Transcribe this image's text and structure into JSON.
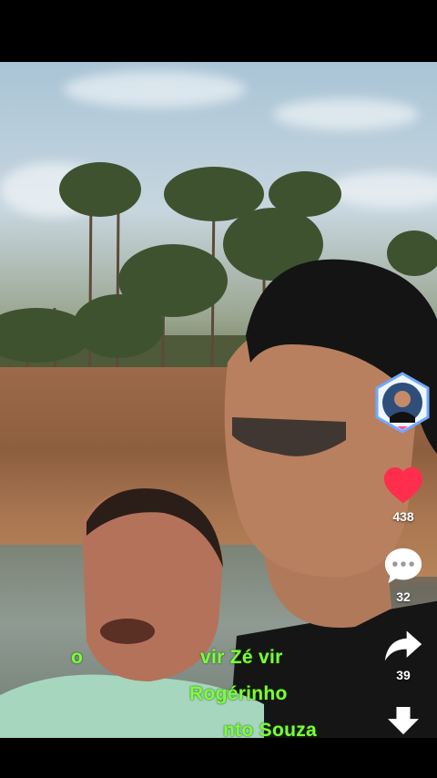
{
  "captions": {
    "line1_prefix": "o",
    "line1": "vir Zé vir",
    "line2": "Rogérinho",
    "line3": "nto Souza"
  },
  "actions": {
    "like_count": "438",
    "comment_count": "32",
    "share_count": "39"
  },
  "icons": {
    "like": "heart-icon",
    "comment": "comment-bubble-icon",
    "share": "share-arrow-icon",
    "download": "download-arrow-icon",
    "profile": "profile-avatar"
  },
  "colors": {
    "caption": "#7cff3c",
    "like": "#ff2e4d",
    "icon": "#ffffff",
    "avatar_ring": "#6ea8ff"
  }
}
